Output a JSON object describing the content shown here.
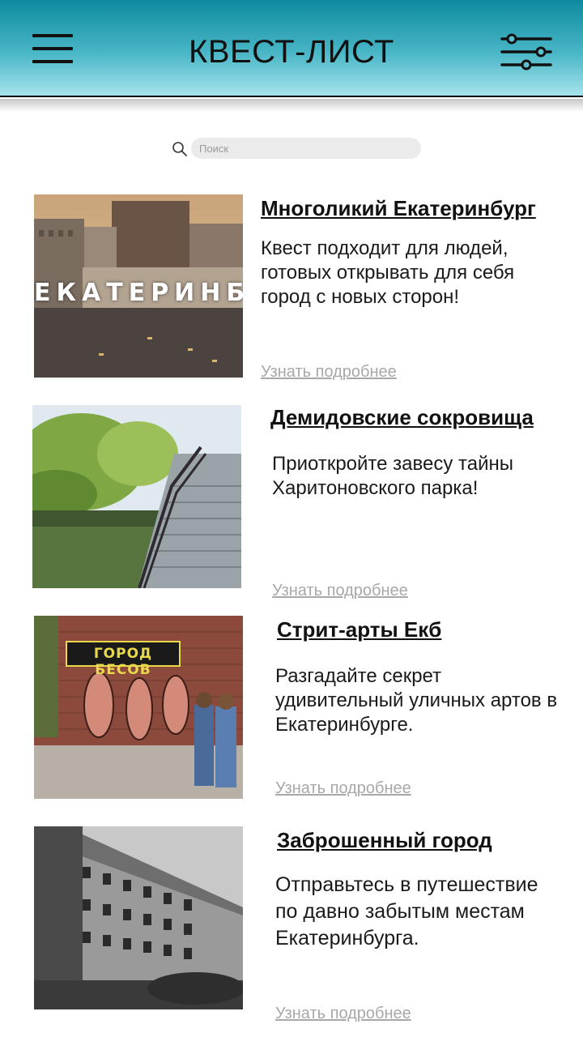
{
  "header": {
    "title": "КВЕСТ-ЛИСТ",
    "menu_icon": "hamburger-menu-icon",
    "filter_icon": "sliders-filter-icon",
    "gradient_top": "#0e8a9f",
    "gradient_bottom": "#a6e3ec"
  },
  "search": {
    "placeholder": "Поиск",
    "icon": "search-icon"
  },
  "quests": [
    {
      "title": "Многоликий Екатеринбург",
      "description": "Квест подходит для людей, готовых открывать для себя город с новых сторон!",
      "link": "Узнать подробнее",
      "image_text": "ЕКАТЕРИНБУРГ"
    },
    {
      "title": "Демидовские сокровища",
      "description": "Приоткройте завесу тайны Харитоновского парка!",
      "link": "Узнать подробнее"
    },
    {
      "title": "Стрит-арты Екб",
      "description": "Разгадайте секрет удивительный уличных артов в Екатеринбурге.",
      "link": "Узнать подробнее",
      "image_text": "ГОРОД БЕСОВ"
    },
    {
      "title": "Заброшенный город",
      "description": "Отправьтесь в путешествие по давно забытым местам Екатеринбурга.",
      "link": "Узнать подробнее"
    }
  ]
}
